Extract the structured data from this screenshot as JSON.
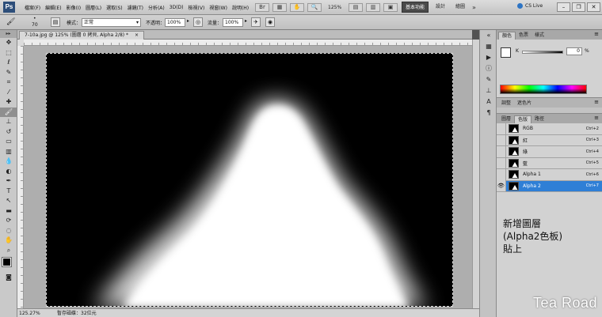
{
  "app": {
    "logo": "Ps"
  },
  "menu": {
    "items": [
      "檔案(F)",
      "編輯(E)",
      "影像(I)",
      "圖層(L)",
      "選取(S)",
      "濾鏡(T)",
      "分析(A)",
      "3D(D)",
      "檢視(V)",
      "視窗(W)",
      "說明(H)"
    ]
  },
  "appbar": {
    "zoom": "125%"
  },
  "workspace": {
    "items": [
      "基本功能",
      "設計",
      "繪圖"
    ],
    "active": "基本功能",
    "more": "»"
  },
  "cslive": {
    "label": "CS Live"
  },
  "options": {
    "brush_size": "70",
    "mode_label": "模式：",
    "mode_value": "正常",
    "opacity_label": "不透明：",
    "opacity_value": "100%",
    "flow_label": "流量：",
    "flow_value": "100%"
  },
  "document": {
    "tab_title": "7-10a.jpg @ 125% (圖層 0 拷貝, Alpha 2/8) *",
    "zoom": "125.27%",
    "status": "暫存磁碟：32位元"
  },
  "panels": {
    "top_tabs": [
      "顏色",
      "色票",
      "樣式"
    ],
    "top_active": "顏色",
    "color": {
      "channel": "K",
      "value": "0",
      "unit": "%"
    },
    "adj_tabs": [
      "調整",
      "遮色片"
    ],
    "bottom_tabs": [
      "圖層",
      "色版",
      "路徑"
    ],
    "bottom_active": "色版",
    "channels": [
      {
        "name": "RGB",
        "shortcut": "Ctrl+2",
        "visible": false,
        "selected": false
      },
      {
        "name": "紅",
        "shortcut": "Ctrl+3",
        "visible": false,
        "selected": false
      },
      {
        "name": "綠",
        "shortcut": "Ctrl+4",
        "visible": false,
        "selected": false
      },
      {
        "name": "藍",
        "shortcut": "Ctrl+5",
        "visible": false,
        "selected": false
      },
      {
        "name": "Alpha 1",
        "shortcut": "Ctrl+6",
        "visible": false,
        "selected": false
      },
      {
        "name": "Alpha 2",
        "shortcut": "Ctrl+7",
        "visible": true,
        "selected": true
      }
    ]
  },
  "annotation": {
    "text": "新增圖層\n(Alpha2色板)\n貼上"
  },
  "watermark": "Tea Road",
  "colors": {
    "selection_blue": "#2f7fd6",
    "canvas_black": "#000000"
  }
}
